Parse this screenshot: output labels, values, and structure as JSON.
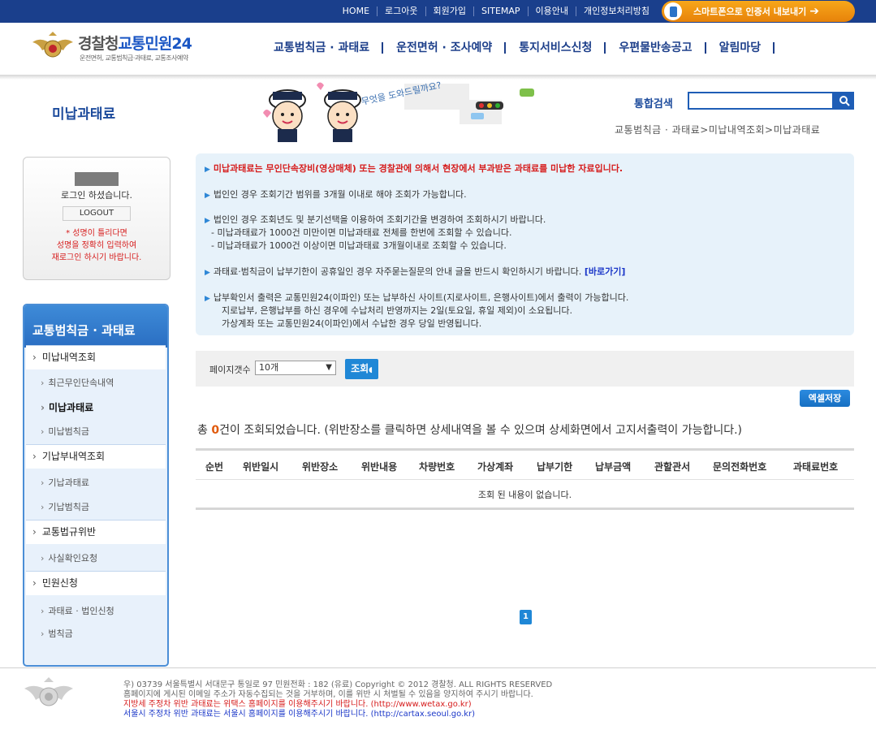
{
  "top_nav": {
    "links": [
      "HOME",
      "로그아웃",
      "회원가입",
      "SITEMAP",
      "이용안내",
      "개인정보처리방침"
    ],
    "smart_button": "스마트폰으로 인증서 내보내기"
  },
  "header": {
    "logo_brand": "경찰청",
    "logo_service": "교통민원24",
    "logo_subtitle": "운전면허, 교통범칙금·과태료, 교통조사예약",
    "menu": [
      "교통범칙금 · 과태료",
      "운전면허 · 조사예약",
      "통지서비스신청",
      "우편물반송공고",
      "알림마당"
    ]
  },
  "page": {
    "title": "미납과태료",
    "illustration_text": "무엇을 도와드릴까요?",
    "search_label": "통합검색",
    "search_value": "",
    "breadcrumb": "교통범칙금 · 과태료>미납내역조회>미납과태료"
  },
  "login": {
    "message": "로그인 하셨습니다.",
    "logout_label": "LOGOUT",
    "warning": [
      "* 성명이 틀리다면",
      "성명을 정확히 입력하여",
      "재로그인 하시기 바랍니다."
    ]
  },
  "sidebar": {
    "title": "교통범칙금 · 과태료",
    "items": [
      {
        "label": "미납내역조회",
        "type": "main"
      },
      {
        "label": "최근무인단속내역",
        "type": "sub"
      },
      {
        "label": "미납과태료",
        "type": "sub",
        "active": true
      },
      {
        "label": "미납범칙금",
        "type": "sub"
      },
      {
        "label": "기납부내역조회",
        "type": "main"
      },
      {
        "label": "기납과태료",
        "type": "sub"
      },
      {
        "label": "기납범칙금",
        "type": "sub"
      },
      {
        "label": "교통법규위반",
        "type": "main"
      },
      {
        "label": "사실확인요청",
        "type": "sub"
      },
      {
        "label": "민원신청",
        "type": "main"
      },
      {
        "label": "과태료 · 법인신청",
        "type": "sub"
      },
      {
        "label": "범칙금",
        "type": "sub"
      }
    ]
  },
  "info": {
    "line1": "미납과태료는 무인단속장비(영상매체) 또는 경찰관에 의해서 현장에서 부과받은 과태료를 미납한 자료입니다.",
    "line2": "법인인 경우 조회기간 범위를 3개월 이내로 해야 조회가 가능합니다.",
    "line3": "법인인 경우 조회년도 및 분기선택을 이용하여 조회기간을 변경하여 조회하시기 바랍니다.",
    "line3a": "- 미납과태료가 1000건 미만이면 미납과태료 전체를 한번에 조회할 수 있습니다.",
    "line3b": "- 미납과태료가 1000건 이상이면 미납과태료 3개월이내로 조회할 수 있습니다.",
    "line4": "과태료·범칙금이 납부기한이 공휴일인 경우 자주묻는질문의 안내 글을 반드시 확인하시기 바랍니다.",
    "line4_link": "[바로가기]",
    "line5": "납부확인서 출력은 교통민원24(이파인) 또는 납부하신 사이트(지로사이트, 은행사이트)에서 출력이 가능합니다.",
    "line5a": "지로납부, 은행납부를 하신 경우에 수납처리 반영까지는 2일(토요일, 휴일 제외)이 소요됩니다.",
    "line5b": "가상계좌 또는 교통민원24(이파인)에서 수납한 경우 당일 반영됩니다."
  },
  "filter": {
    "label": "페이지갯수",
    "select_value": "10개",
    "search_button": "조회"
  },
  "excel_button": "엑셀저장",
  "result": {
    "prefix": "총 ",
    "count": "0",
    "suffix": "건이 조회되었습니다. (위반장소를 클릭하면 상세내역을 볼 수 있으며 상세화면에서 고지서출력이 가능합니다.)"
  },
  "table": {
    "headers": [
      "순번",
      "위반일시",
      "위반장소",
      "위반내용",
      "차량번호",
      "가상계좌",
      "납부기한",
      "납부금액",
      "관할관서",
      "문의전화번호",
      "과태료번호"
    ],
    "empty_message": "조회 된 내용이 없습니다."
  },
  "pagination": {
    "current": "1"
  },
  "footer": {
    "address": "우) 03739 서울특별시 서대문구 통일로 97  민원전화 : 182 (유료)        Copyright © 2012 경찰청. ALL RIGHTS RESERVED",
    "notice": "홈페이지에 게시된 이메일 주소가 자동수집되는 것을 거부하며, 이를 위반 시 처벌될 수 있음을 양지하여 주시기 바랍니다.",
    "wetax": "지방세 주정차 위반 과태료는 위택스 홈페이지를 이용해주시기 바랍니다. (http://www.wetax.go.kr)",
    "seoul": "서울시 주정차 위반 과태료는 서울시 홈페이지를 이용해주시기 바랍니다. (http://cartax.seoul.go.kr)"
  },
  "colors": {
    "topbar": "#1a3f8c",
    "accent": "#1f87d6",
    "menu_text": "#1d3f8a",
    "warning": "#d61c1c"
  }
}
